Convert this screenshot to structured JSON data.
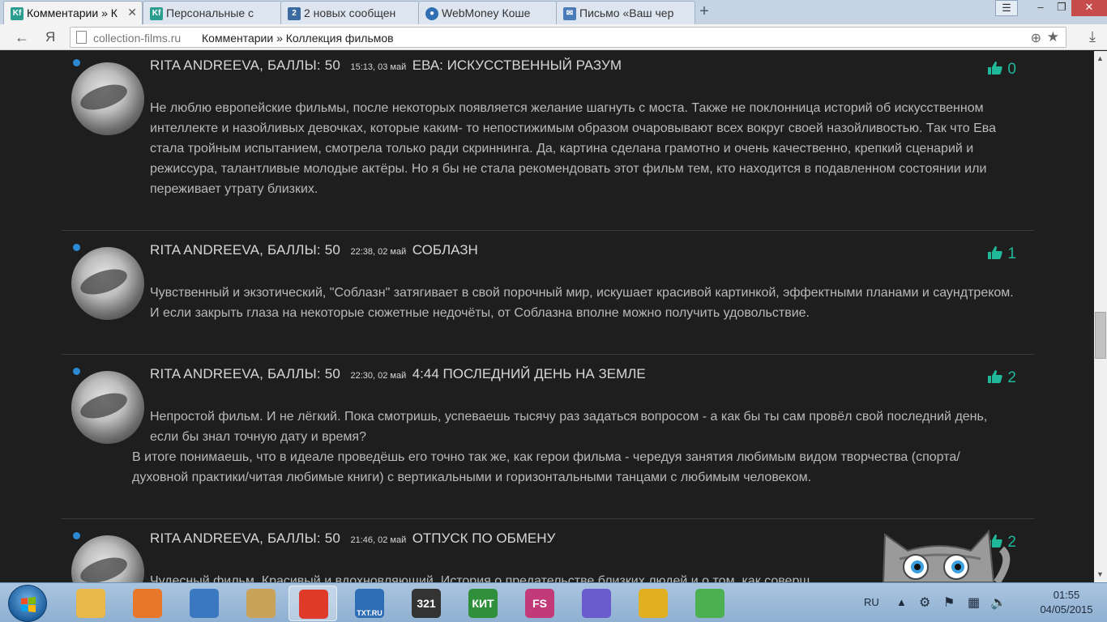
{
  "browser": {
    "tabs": [
      {
        "title": "Комментарии » К",
        "active": true,
        "icon": "kf-favicon",
        "color": "#2a9d8f"
      },
      {
        "title": "Персональные с",
        "active": false,
        "icon": "kf-favicon",
        "color": "#2a9d8f"
      },
      {
        "title": "2 новых сообщен",
        "active": false,
        "icon": "mail-2-favicon",
        "color": "#3b6aa0"
      },
      {
        "title": "WebMoney Коше",
        "active": false,
        "icon": "webmoney-globe-icon",
        "color": "#2f6fb2"
      },
      {
        "title": "Письмо «Ваш чер",
        "active": false,
        "icon": "envelope-icon",
        "color": "#4a7ab8"
      }
    ],
    "new_tab": "+",
    "address": {
      "host": "collection-films.ru",
      "page_title": "Комментарии » Коллекция фильмов"
    },
    "window_controls": {
      "minimize": "–",
      "restore": "❐",
      "close": "✕",
      "menu": "☰"
    },
    "nav": {
      "back": "←",
      "yandex": "Я"
    }
  },
  "comments": [
    {
      "author": "RITA ANDREEVA, БАЛЛЫ: 50",
      "time": "15:13, 03 май",
      "film": "ЕВА: ИСКУССТВЕННЫЙ РАЗУМ",
      "likes": "0",
      "paragraphs": [
        {
          "text": "Не люблю европейские фильмы, после некоторых появляется желание шагнуть с моста. Также не поклонница историй об искусственном интеллекте и назойливых девочках, которые каким- то непостижимым образом очаровывают всех вокруг своей назойливостью. Так что Ева стала тройным испытанием, смотрела только ради скриннинга. Да, картина сделана грамотно и очень качественно, крепкий сценарий и режиссура, талантливые молодые актёры. Но я бы не стала рекомендовать этот фильм тем, кто находится в подавленном состоянии или переживает утрату близких."
        }
      ]
    },
    {
      "author": "RITA ANDREEVA, БАЛЛЫ: 50",
      "time": "22:38, 02 май",
      "film": "СОБЛАЗН",
      "likes": "1",
      "paragraphs": [
        {
          "text": "Чувственный и экзотический, \"Соблазн\" затягивает в свой порочный мир, искушает красивой картинкой, эффектными планами и саундтреком. И если закрыть глаза на некоторые сюжетные недочёты, от Соблазна вполне можно получить удовольствие."
        }
      ]
    },
    {
      "author": "RITA ANDREEVA, БАЛЛЫ: 50",
      "time": "22:30, 02 май",
      "film": "4:44 ПОСЛЕДНИЙ ДЕНЬ НА ЗЕМЛЕ",
      "likes": "2",
      "paragraphs": [
        {
          "text": "Непростой фильм. И не лёгкий. Пока смотришь, успеваешь тысячу раз задаться вопросом - а как бы ты сам провёл свой последний день, если бы знал точную дату и время?"
        },
        {
          "text": "В итоге понимаешь, что в идеале проведёшь его точно так же, как герои фильма - чередуя занятия любимым видом творчества (спорта/духовной практики/читая любимые книги) с вертикальными и горизонтальными танцами с любимым человеком."
        }
      ]
    },
    {
      "author": "RITA ANDREEVA, БАЛЛЫ: 50",
      "time": "21:46, 02 май",
      "film": "ОТПУСК ПО ОБМЕНУ",
      "likes": "2",
      "paragraphs": [
        {
          "text": "Чудесный фильм. Красивый и вдохновляющий. История о предательстве близких людей и о том, как соверш"
        }
      ]
    }
  ],
  "taskbar": {
    "apps": [
      {
        "name": "explorer-icon",
        "label": "",
        "color": "#e8b84a"
      },
      {
        "name": "media-player-icon",
        "label": "",
        "color": "#e8772a"
      },
      {
        "name": "qip-icon",
        "label": "",
        "color": "#3a78c2"
      },
      {
        "name": "paint-icon",
        "label": "",
        "color": "#c9a35a"
      },
      {
        "name": "yandex-browser-icon",
        "label": "",
        "color": "#e03a2a"
      },
      {
        "name": "txt-ru-icon",
        "label": "TXT.RU",
        "color": "#2c6db5"
      },
      {
        "name": "calendar-321-icon",
        "label": "321",
        "color": "#333333"
      },
      {
        "name": "kit-icon",
        "label": "КИТ",
        "color": "#2f8f3a"
      },
      {
        "name": "fs-icon",
        "label": "FS",
        "color": "#c23a78"
      },
      {
        "name": "picasa-icon",
        "label": "",
        "color": "#6a5acd"
      },
      {
        "name": "qip-bird-icon",
        "label": "",
        "color": "#e0b020"
      },
      {
        "name": "evernote-icon",
        "label": "",
        "color": "#4caf50"
      }
    ],
    "lang": "RU",
    "time": "01:55",
    "date": "04/05/2015"
  },
  "colors": {
    "accent": "#1fb89a",
    "online": "#2b8ad6",
    "background": "#1e1e1e",
    "text": "#b9b9b9"
  }
}
